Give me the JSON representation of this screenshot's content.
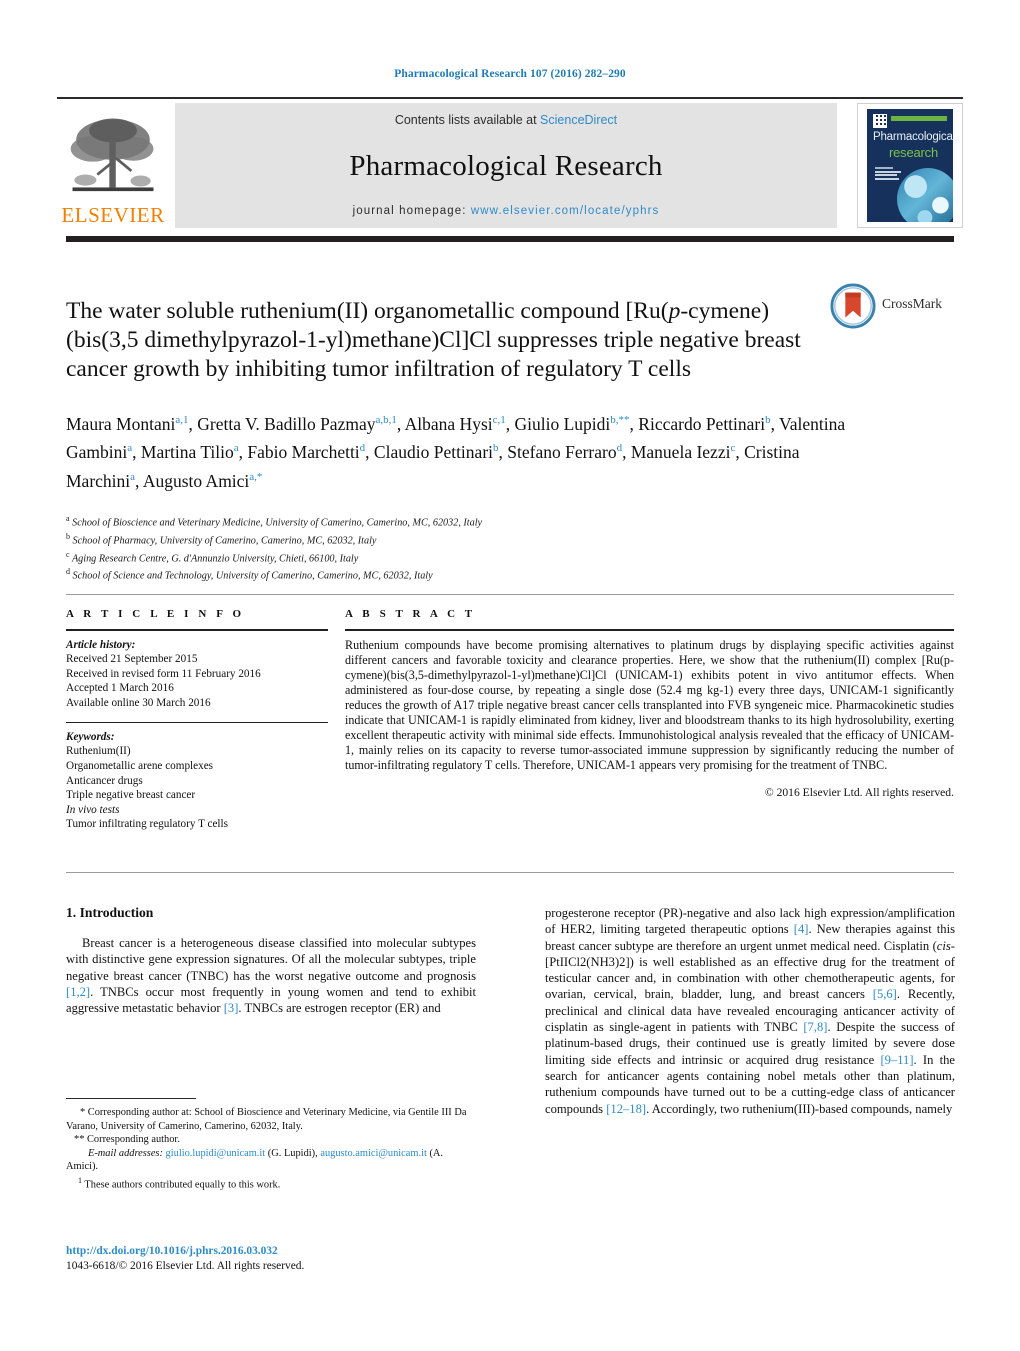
{
  "running_head": "Pharmacological Research 107 (2016) 282–290",
  "masthead": {
    "publisher_name": "ELSEVIER",
    "contents_prefix": "Contents lists available at ",
    "contents_link": "ScienceDirect",
    "journal_title": "Pharmacological Research",
    "homepage_prefix": "journal homepage: ",
    "homepage_url": "www.elsevier.com/locate/yphrs",
    "cover": {
      "line1": "Pharmacological",
      "line2": "research"
    }
  },
  "crossmark": {
    "label": "CrossMark"
  },
  "article": {
    "title_part1": "The water soluble ruthenium(II) organometallic compound [Ru(",
    "title_italic": "p",
    "title_part2": "-cymene)(bis(3,5 dimethylpyrazol-1-yl)methane)Cl]Cl suppresses triple negative breast cancer growth by inhibiting tumor infiltration of regulatory T cells",
    "authors_line1": "Maura Montani",
    "authors_full": "Maura Montani a,1, Gretta V. Badillo Pazmay a,b,1, Albana Hysi c,1, Giulio Lupidi b,**, Riccardo Pettinari b, Valentina Gambini a, Martina Tilio a, Fabio Marchetti d, Claudio Pettinari b, Stefano Ferraro d, Manuela Iezzi c, Cristina Marchini a, Augusto Amici a,*",
    "affiliations": [
      {
        "marker": "a",
        "text": "School of Bioscience and Veterinary Medicine, University of Camerino, Camerino, MC, 62032, Italy"
      },
      {
        "marker": "b",
        "text": "School of Pharmacy, University of Camerino, Camerino, MC, 62032, Italy"
      },
      {
        "marker": "c",
        "text": "Aging Research Centre, G. d'Annunzio University, Chieti, 66100, Italy"
      },
      {
        "marker": "d",
        "text": "School of Science and Technology, University of Camerino, Camerino, MC, 62032, Italy"
      }
    ]
  },
  "article_info": {
    "heading": "A R T I C L E   I N F O",
    "history_label": "Article history:",
    "history": [
      "Received 21 September 2015",
      "Received in revised form 11 February 2016",
      "Accepted 1 March 2016",
      "Available online 30 March 2016"
    ],
    "keywords_label": "Keywords:",
    "keywords": [
      "Ruthenium(II)",
      "Organometallic arene complexes",
      "Anticancer drugs",
      "Triple negative breast cancer",
      "In vivo tests",
      "Tumor infiltrating regulatory T cells"
    ]
  },
  "abstract": {
    "heading": "A B S T R A C T",
    "text": "Ruthenium compounds have become promising alternatives to platinum drugs by displaying specific activities against different cancers and favorable toxicity and clearance properties. Here, we show that the ruthenium(II) complex [Ru(p-cymene)(bis(3,5-dimethylpyrazol-1-yl)methane)Cl]Cl (UNICAM-1) exhibits potent in vivo antitumor effects. When administered as four-dose course, by repeating a single dose (52.4 mg kg-1) every three days, UNICAM-1 significantly reduces the growth of A17 triple negative breast cancer cells transplanted into FVB syngeneic mice. Pharmacokinetic studies indicate that UNICAM-1 is rapidly eliminated from kidney, liver and bloodstream thanks to its high hydrosolubility, exerting excellent therapeutic activity with minimal side effects. Immunohistological analysis revealed that the efficacy of UNICAM-1, mainly relies on its capacity to reverse tumor-associated immune suppression by significantly reducing the number of tumor-infiltrating regulatory T cells. Therefore, UNICAM-1 appears very promising for the treatment of TNBC.",
    "copyright": "© 2016 Elsevier Ltd. All rights reserved."
  },
  "body": {
    "section_heading": "1. Introduction",
    "left_paragraph": "Breast cancer is a heterogeneous disease classified into molecular subtypes with distinctive gene expression signatures. Of all the molecular subtypes, triple negative breast cancer (TNBC) has the worst negative outcome and prognosis [1,2]. TNBCs occur most frequently in young women and tend to exhibit aggressive metastatic behavior [3]. TNBCs are estrogen receptor (ER) and",
    "right_paragraph": "progesterone receptor (PR)-negative and also lack high expression/amplification of HER2, limiting targeted therapeutic options [4]. New therapies against this breast cancer subtype are therefore an urgent unmet medical need. Cisplatin (cis-[PtIICl2(NH3)2]) is well established as an effective drug for the treatment of testicular cancer and, in combination with other chemotherapeutic agents, for ovarian, cervical, brain, bladder, lung, and breast cancers [5,6]. Recently, preclinical and clinical data have revealed encouraging anticancer activity of cisplatin as single-agent in patients with TNBC [7,8]. Despite the success of platinum-based drugs, their continued use is greatly limited by severe dose limiting side effects and intrinsic or acquired drug resistance [9–11]. In the search for anticancer agents containing nobel metals other than platinum, ruthenium compounds have turned out to be a cutting-edge class of anticancer compounds [12–18]. Accordingly, two ruthenium(III)-based compounds, namely"
  },
  "footnotes": {
    "corresponding_1": "* Corresponding author at: School of Bioscience and Veterinary Medicine, via Gentile III Da Varano, University of Camerino, Camerino, 62032, Italy.",
    "corresponding_2": "** Corresponding author.",
    "email_label": "E-mail addresses:",
    "email_1": "giulio.lupidi@unicam.it",
    "email_1_owner": "(G. Lupidi),",
    "email_2": "augusto.amici@unicam.it",
    "email_2_owner": "(A. Amici).",
    "equal_contribution": "1  These authors contributed equally to this work."
  },
  "doi_block": {
    "doi_url": "http://dx.doi.org/10.1016/j.phrs.2016.03.032",
    "issn_line": "1043-6618/© 2016 Elsevier Ltd. All rights reserved."
  },
  "colors": {
    "link_blue": "#2e8bc9",
    "elsevier_orange": "#F08000",
    "cover_navy": "#16325c",
    "cover_green": "#6cb33f",
    "band_grey": "#e3e3e3"
  }
}
